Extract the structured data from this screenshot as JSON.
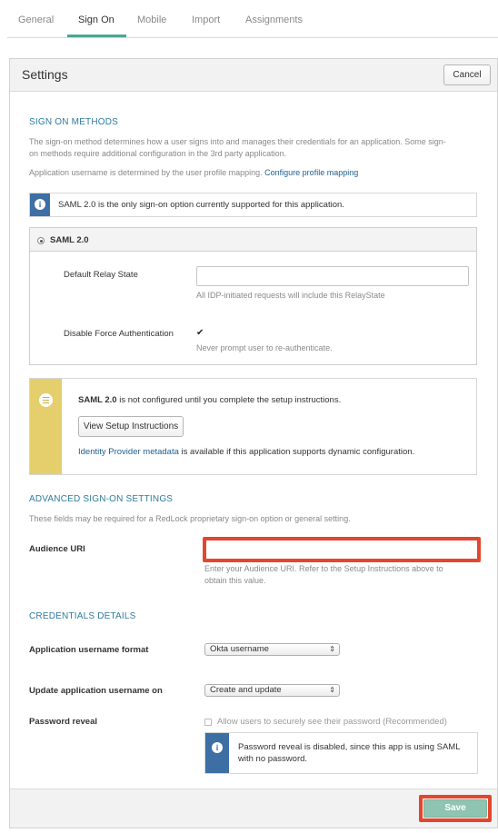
{
  "tabs": [
    {
      "label": "General"
    },
    {
      "label": "Sign On"
    },
    {
      "label": "Mobile"
    },
    {
      "label": "Import"
    },
    {
      "label": "Assignments"
    }
  ],
  "settings": {
    "title": "Settings",
    "cancel_label": "Cancel"
  },
  "sign_on_methods": {
    "heading": "SIGN ON METHODS",
    "description_line1": "The sign-on method determines how a user signs into and manages their credentials for an application. Some sign-",
    "description_line2": "on methods require additional configuration in the 3rd party application.",
    "username_text": "Application username is determined by the user profile mapping.",
    "username_link": "Configure profile mapping",
    "info_text": "SAML 2.0 is the only sign-on option currently supported for this application.",
    "saml_option": "SAML 2.0",
    "relay_state_label": "Default Relay State",
    "relay_state_value": "",
    "relay_state_hint": "All IDP-initiated requests will include this RelayState",
    "force_auth_label": "Disable Force Authentication",
    "force_auth_checked": true,
    "force_auth_mark": "✔",
    "force_auth_hint": "Never prompt user to re-authenticate."
  },
  "setup": {
    "bold": "SAML 2.0",
    "text": " is not configured until you complete the setup instructions.",
    "button_label": "View Setup Instructions",
    "metadata_link": "Identity Provider metadata",
    "metadata_text": " is available if this application supports dynamic configuration."
  },
  "advanced": {
    "heading": "ADVANCED SIGN-ON SETTINGS",
    "description": "These fields may be required for a RedLock proprietary sign-on option or general setting.",
    "audience_label": "Audience URI",
    "audience_value": "",
    "audience_hint_line1": "Enter your Audience URI. Refer to the Setup Instructions above to",
    "audience_hint_line2": "obtain this value."
  },
  "credentials": {
    "heading": "CREDENTIALS DETAILS",
    "format_label": "Application username format",
    "format_value": "Okta username",
    "update_label": "Update application username on",
    "update_value": "Create and update",
    "password_label": "Password reveal",
    "password_checkbox_label": "Allow users to securely see their password (Recommended)",
    "password_checked": false,
    "password_info": "Password reveal is disabled, since this app is using SAML with no password."
  },
  "footer": {
    "save_label": "Save"
  },
  "colors": {
    "accent": "#4aa790",
    "heading_blue": "#2f7b9d",
    "info_blue": "#3d6fa5",
    "setup_yellow": "#e5cf6c",
    "highlight_red": "#e2472d"
  },
  "icons": {
    "info": "i"
  }
}
